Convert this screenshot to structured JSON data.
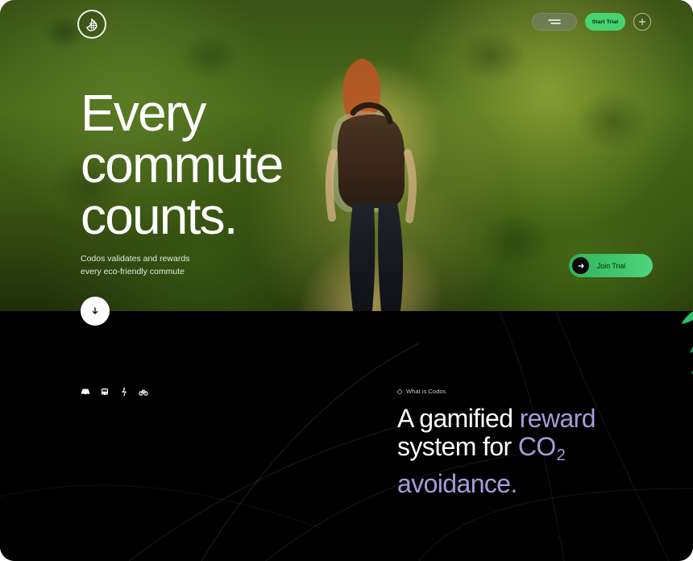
{
  "hero": {
    "headline_lines": [
      "Every",
      "commute",
      "counts."
    ],
    "subtext_lines": [
      "Codos validates and rewards",
      "every eco-friendly commute"
    ],
    "scroll_down_icon": "arrow-down-icon",
    "cta": {
      "label": "Join Trial",
      "icon": "arrow-right-icon"
    }
  },
  "nav": {
    "logo_icon": "leaf-grid-logo-icon",
    "menu_icon": "menu-icon",
    "start_trial_label": "Start Trial",
    "action_icon": "plus-circle-icon"
  },
  "section": {
    "transport_icons": [
      "car-icon",
      "bus-icon",
      "walking-icon",
      "bike-icon"
    ],
    "kicker": "What is Codos",
    "statement": {
      "part1": "A gamified ",
      "part2": "reward",
      "line2_part1": "system for ",
      "line2_part2": "CO",
      "line2_sub": "2",
      "line3": "avoidance."
    }
  },
  "colors": {
    "accent_green": "#47d46e",
    "accent_purple": "#a99ad9",
    "dark_bg": "#000000"
  }
}
